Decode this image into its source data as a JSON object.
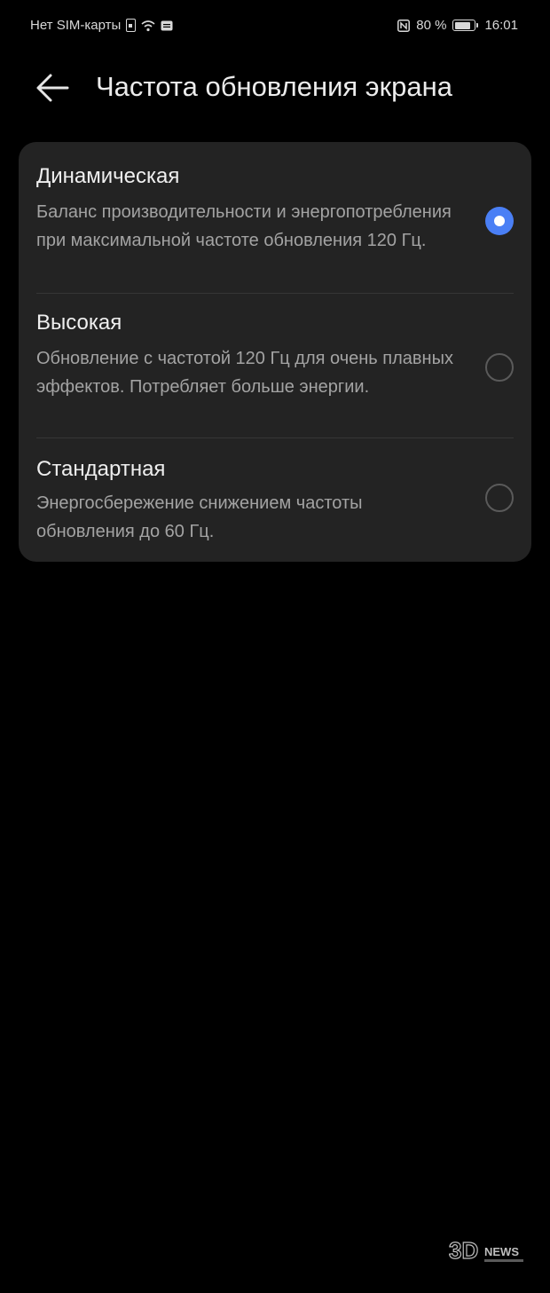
{
  "status_bar": {
    "sim_text": "Нет SIM-карты",
    "battery_percent": "80 %",
    "battery_level": 0.8,
    "time": "16:01",
    "icons": [
      "sim-icon",
      "wifi-icon",
      "message-icon",
      "nfc-icon",
      "battery-icon"
    ]
  },
  "header": {
    "title": "Частота обновления экрана",
    "back_icon": "arrow-left-icon"
  },
  "options": [
    {
      "title": "Динамическая",
      "description": "Баланс производительности и энергопотребления при максимальной частоте обновления 120 Гц.",
      "selected": true
    },
    {
      "title": "Высокая",
      "description": "Обновление с частотой 120 Гц для очень плавных эффектов. Потребляет больше энергии.",
      "selected": false
    },
    {
      "title": "Стандартная",
      "description": "Энергосбережение снижением частоты обновления до 60 Гц.",
      "selected": false
    }
  ],
  "colors": {
    "background": "#000000",
    "card": "#232323",
    "accent": "#4a7ff5",
    "title_text": "#efefef",
    "secondary_text": "#a3a3a3"
  },
  "watermark": {
    "logo": "3DNews"
  }
}
